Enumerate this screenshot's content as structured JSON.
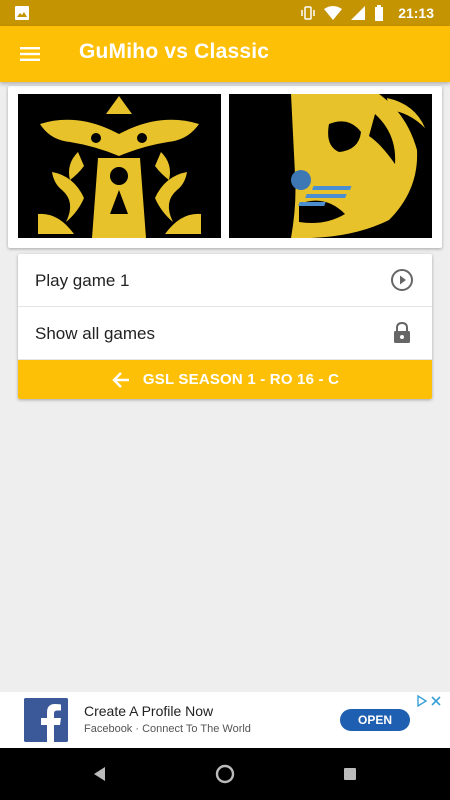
{
  "status_bar": {
    "time": "21:13",
    "icons": [
      "gallery-icon",
      "vibrate-icon",
      "wifi-icon",
      "signal-icon",
      "battery-icon"
    ]
  },
  "app_bar": {
    "title": "GuMiho vs Classic",
    "menu_icon": "hamburger-menu-icon",
    "color": "#fdc007"
  },
  "matchup": {
    "left_race": "terran-emblem",
    "right_race": "protoss-emblem"
  },
  "menu": {
    "items": [
      {
        "label": "Play game 1",
        "icon": "play-circle-icon"
      },
      {
        "label": "Show all games",
        "icon": "lock-icon"
      }
    ],
    "back": {
      "label": "GSL SEASON 1 - RO 16 - C",
      "icon": "arrow-back-icon"
    }
  },
  "ad": {
    "title": "Create A Profile Now",
    "subtitle": "Facebook · Connect To The World",
    "button": "OPEN",
    "logo": "facebook-logo",
    "accent": "#1f5fb1"
  },
  "nav_bar": {
    "buttons": [
      "back-triangle-icon",
      "home-circle-icon",
      "recents-square-icon"
    ]
  }
}
